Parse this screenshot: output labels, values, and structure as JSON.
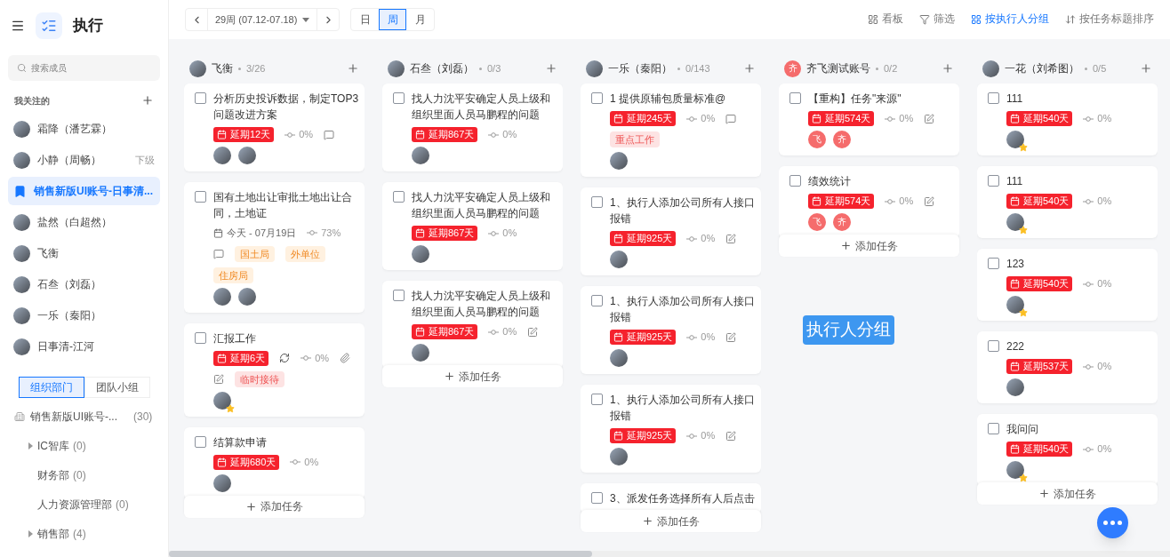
{
  "app": {
    "title": "执行"
  },
  "sidebar": {
    "search": {
      "placeholder": "搜索成员"
    },
    "followed_title": "我关注的",
    "members": [
      {
        "name": "霜降（潘艺霖）",
        "kind": "avatar",
        "selected": false
      },
      {
        "name": "小静（周畅）",
        "kind": "avatar",
        "note": "下级",
        "selected": false
      },
      {
        "name": "销售新版UI账号-日事清...",
        "kind": "bookmark",
        "selected": true
      },
      {
        "name": "盐然（白超然）",
        "kind": "avatar",
        "selected": false
      },
      {
        "name": "飞衡",
        "kind": "avatar",
        "selected": false
      },
      {
        "name": "石叁（刘磊）",
        "kind": "avatar",
        "selected": false
      },
      {
        "name": "一乐（秦阳）",
        "kind": "avatar",
        "selected": false
      },
      {
        "name": "日事清-江河",
        "kind": "avatar",
        "selected": false
      }
    ],
    "org_tabs": [
      {
        "label": "组织部门",
        "selected": true
      },
      {
        "label": "团队小组",
        "selected": false
      }
    ],
    "tree": [
      {
        "label": "销售新版UI账号-...",
        "count": "(30)",
        "children": [
          {
            "label": "IC智库",
            "count": "(0)",
            "expanded": false
          },
          {
            "label": "财务部",
            "count": "(0)"
          },
          {
            "label": "人力资源管理部",
            "count": "(0)"
          },
          {
            "label": "销售部",
            "count": "(4)",
            "expanded": false
          }
        ]
      }
    ]
  },
  "toolbar": {
    "week": "29周 (07.12-07.18)",
    "views": [
      {
        "label": "日",
        "selected": false
      },
      {
        "label": "周",
        "selected": true
      },
      {
        "label": "月",
        "selected": false
      }
    ],
    "actions": [
      {
        "label": "看板",
        "kind": "board",
        "selected": false
      },
      {
        "label": "筛选",
        "kind": "filter",
        "selected": false
      },
      {
        "label": "按执行人分组",
        "kind": "group",
        "selected": true
      },
      {
        "label": "按任务标题排序",
        "kind": "sort",
        "selected": false
      }
    ]
  },
  "columns": [
    {
      "name": "飞衡",
      "avatar": {
        "kind": "photo"
      },
      "count": "3/26",
      "add_label": "添加任务",
      "cards": [
        {
          "title": "分析历史投诉数据，制定TOP3问题改进方案",
          "checked": false,
          "due": {
            "kind": "overdue",
            "text": "延期12天"
          },
          "progress": "0%",
          "comment": true,
          "avatars": [
            {
              "kind": "photo"
            },
            {
              "kind": "photo"
            }
          ]
        },
        {
          "title": "国有土地出让审批土地出让合同，土地证",
          "checked": false,
          "due": {
            "kind": "date",
            "text": "今天 - 07月19日"
          },
          "progress": "73%",
          "comment": true,
          "tags": [
            {
              "label": "国土局",
              "kind": "orange"
            },
            {
              "label": "外单位",
              "kind": "orange"
            },
            {
              "label": "住房局",
              "kind": "orange"
            }
          ],
          "avatars": [
            {
              "kind": "photo"
            },
            {
              "kind": "photo"
            }
          ]
        },
        {
          "title": "汇报工作",
          "checked": false,
          "due": {
            "kind": "overdue",
            "text": "延期6天"
          },
          "repeat": true,
          "progress": "0%",
          "attachment": true,
          "edit": true,
          "tags": [
            {
              "label": "临时接待",
              "kind": "pink"
            }
          ],
          "avatars": [
            {
              "kind": "photo",
              "starred": true
            }
          ]
        },
        {
          "title": "结算款申请",
          "checked": false,
          "due": {
            "kind": "overdue",
            "text": "延期680天"
          },
          "progress": "0%",
          "avatars": [
            {
              "kind": "photo"
            }
          ]
        }
      ]
    },
    {
      "name": "石叁（刘磊）",
      "avatar": {
        "kind": "photo"
      },
      "count": "0/3",
      "add_label": "添加任务",
      "cards": [
        {
          "title": "找人力沈平安确定人员上级和组织里面人员马鹏程的问题",
          "checked": false,
          "due": {
            "kind": "overdue",
            "text": "延期867天"
          },
          "progress": "0%",
          "avatars": [
            {
              "kind": "photo"
            }
          ]
        },
        {
          "title": "找人力沈平安确定人员上级和组织里面人员马鹏程的问题",
          "checked": false,
          "due": {
            "kind": "overdue",
            "text": "延期867天"
          },
          "progress": "0%",
          "avatars": [
            {
              "kind": "photo"
            }
          ]
        },
        {
          "title": "找人力沈平安确定人员上级和组织里面人员马鹏程的问题",
          "checked": false,
          "due": {
            "kind": "overdue",
            "text": "延期867天"
          },
          "progress": "0%",
          "edit": true,
          "avatars": [
            {
              "kind": "photo"
            }
          ]
        }
      ]
    },
    {
      "name": "一乐（秦阳）",
      "avatar": {
        "kind": "photo"
      },
      "count": "0/143",
      "add_label": "添加任务",
      "cards": [
        {
          "title": "1 提供原辅包质量标准@",
          "checked": false,
          "due": {
            "kind": "overdue",
            "text": "延期245天"
          },
          "progress": "0%",
          "comment": true,
          "tags": [
            {
              "label": "重点工作",
              "kind": "pink"
            }
          ],
          "avatars": [
            {
              "kind": "photo"
            }
          ]
        },
        {
          "title": "1、执行人添加公司所有人接口报错",
          "checked": false,
          "due": {
            "kind": "overdue",
            "text": "延期925天"
          },
          "progress": "0%",
          "edit": true,
          "avatars": [
            {
              "kind": "photo"
            }
          ]
        },
        {
          "title": "1、执行人添加公司所有人接口报错",
          "checked": false,
          "due": {
            "kind": "overdue",
            "text": "延期925天"
          },
          "progress": "0%",
          "edit": true,
          "avatars": [
            {
              "kind": "photo"
            }
          ]
        },
        {
          "title": "1、执行人添加公司所有人接口报错",
          "checked": false,
          "due": {
            "kind": "overdue",
            "text": "延期925天"
          },
          "progress": "0%",
          "edit": true,
          "avatars": [
            {
              "kind": "photo"
            }
          ]
        },
        {
          "title": "3、派发任务选择所有人后点击",
          "checked": false
        }
      ]
    },
    {
      "name": "齐飞测试账号",
      "avatar": {
        "kind": "letter",
        "text": "齐"
      },
      "count": "0/2",
      "add_label": "添加任务",
      "cards": [
        {
          "title": "【重构】任务\"来源\"",
          "checked": false,
          "due": {
            "kind": "overdue",
            "text": "延期574天"
          },
          "progress": "0%",
          "edit": true,
          "avatars": [
            {
              "kind": "letter",
              "text": "飞"
            },
            {
              "kind": "letter",
              "text": "齐"
            }
          ]
        },
        {
          "title": "绩效统计",
          "checked": false,
          "due": {
            "kind": "overdue",
            "text": "延期574天"
          },
          "progress": "0%",
          "edit": true,
          "avatars": [
            {
              "kind": "letter",
              "text": "飞"
            },
            {
              "kind": "letter",
              "text": "齐"
            }
          ]
        }
      ]
    },
    {
      "name": "一花（刘希图）",
      "avatar": {
        "kind": "photo"
      },
      "count": "0/5",
      "add_label": "添加任务",
      "cards": [
        {
          "title": "111",
          "checked": false,
          "due": {
            "kind": "overdue",
            "text": "延期540天"
          },
          "progress": "0%",
          "avatars": [
            {
              "kind": "photo",
              "starred": true
            }
          ]
        },
        {
          "title": "111",
          "checked": false,
          "due": {
            "kind": "overdue",
            "text": "延期540天"
          },
          "progress": "0%",
          "avatars": [
            {
              "kind": "photo",
              "starred": true
            }
          ]
        },
        {
          "title": "123",
          "checked": false,
          "due": {
            "kind": "overdue",
            "text": "延期540天"
          },
          "progress": "0%",
          "avatars": [
            {
              "kind": "photo",
              "starred": true
            }
          ]
        },
        {
          "title": "222",
          "checked": false,
          "due": {
            "kind": "overdue",
            "text": "延期537天"
          },
          "progress": "0%",
          "avatars": [
            {
              "kind": "photo"
            }
          ]
        },
        {
          "title": "我问问",
          "checked": false,
          "due": {
            "kind": "overdue",
            "text": "延期540天"
          },
          "progress": "0%",
          "avatars": [
            {
              "kind": "photo",
              "starred": true
            }
          ]
        }
      ]
    }
  ],
  "overlay_label": "执行人分组"
}
